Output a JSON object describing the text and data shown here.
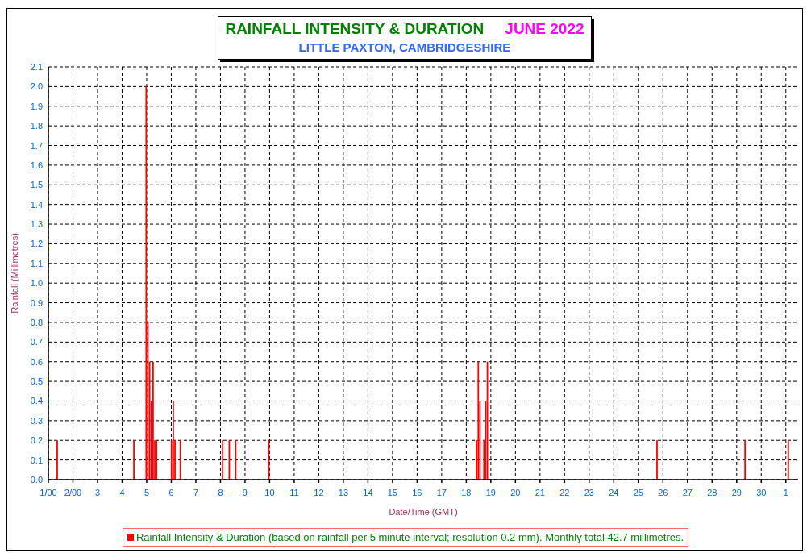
{
  "header": {
    "title": "RAINFALL INTENSITY & DURATION",
    "period": "JUNE 2022",
    "subtitle": "LITTLE PAXTON, CAMBRIDGESHIRE"
  },
  "chart_data": {
    "type": "bar",
    "xlabel": "Date/Time (GMT)",
    "ylabel": "Rainfall (Millimetres)",
    "x": [
      1.36,
      4.48,
      4.98,
      5.05,
      5.12,
      5.19,
      5.26,
      5.33,
      5.4,
      6.01,
      6.08,
      6.15,
      6.37,
      8.09,
      8.36,
      8.62,
      9.97,
      18.42,
      18.49,
      18.56,
      18.72,
      18.79,
      18.86,
      25.76,
      29.34,
      31.1
    ],
    "series": [
      {
        "name": "Rainfall Intensity & Duration",
        "color": "#ff0000",
        "values": [
          0.2,
          0.2,
          2.0,
          0.8,
          0.6,
          0.4,
          0.6,
          0.2,
          0.2,
          0.2,
          0.4,
          0.2,
          0.2,
          0.2,
          0.2,
          0.2,
          0.2,
          0.2,
          0.6,
          0.4,
          0.2,
          0.4,
          0.6,
          0.2,
          0.2,
          0.2
        ]
      }
    ],
    "grid": true,
    "xlim": [
      1,
      31.5
    ],
    "ylim": [
      0,
      2.1
    ],
    "xticks": [
      {
        "value": 1,
        "label": "1/00"
      },
      {
        "value": 2,
        "label": "2/00"
      },
      3,
      4,
      5,
      6,
      7,
      8,
      9,
      10,
      11,
      12,
      13,
      14,
      15,
      16,
      17,
      18,
      19,
      20,
      21,
      22,
      23,
      24,
      25,
      26,
      27,
      28,
      29,
      30
    ],
    "yticks": [
      {
        "value": 0,
        "label": "0.0"
      },
      0.1,
      0.2,
      0.3,
      0.4,
      0.5,
      0.6,
      0.7,
      0.8,
      0.9,
      {
        "value": 1,
        "label": "1.0"
      },
      1.1,
      1.2,
      1.3,
      1.4,
      1.5,
      1.6,
      1.7,
      1.8,
      1.9,
      {
        "value": 2,
        "label": "2.0"
      },
      2.1
    ]
  },
  "next_month_day_label": "1",
  "legend_note": "(based on rainfall per 5 minute interval; resolution 0.2 mm). Monthly total 42.7 millimetres."
}
